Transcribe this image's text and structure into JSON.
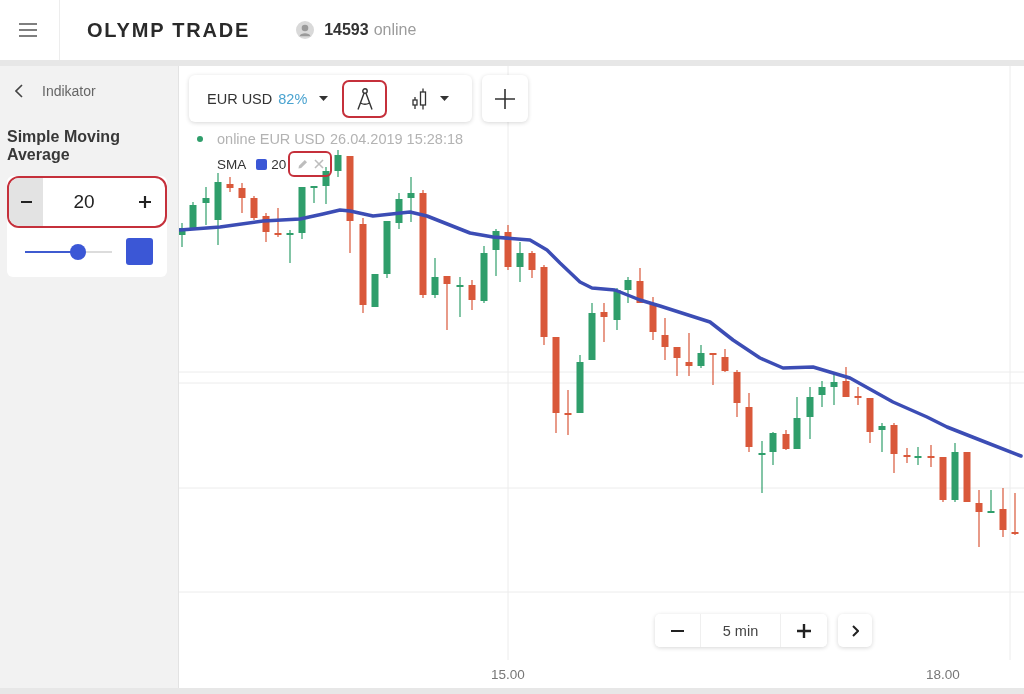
{
  "header": {
    "brand": "OLYMP TRADE",
    "online": {
      "count": "14593",
      "label": "online"
    }
  },
  "indicator_panel": {
    "back_label": "Indikator",
    "title": "Simple Moving Average",
    "period_stepper": {
      "value": "20",
      "highlighted": true
    },
    "period_slider": {
      "level": 0.61
    }
  },
  "chart": {
    "toolbar": {
      "asset": "EUR USD",
      "payout": "82%",
      "drawing_tools": {
        "highlighted": true
      }
    },
    "status": {
      "label": "online EUR USD",
      "timestamp": "26.04.2019 15:28:18"
    },
    "indicator_legend": {
      "name": "SMA",
      "period": "20",
      "actions_highlighted": true
    },
    "timeframe": "5 min",
    "x_axis_labels": [
      "15.00",
      "18.00"
    ]
  }
}
